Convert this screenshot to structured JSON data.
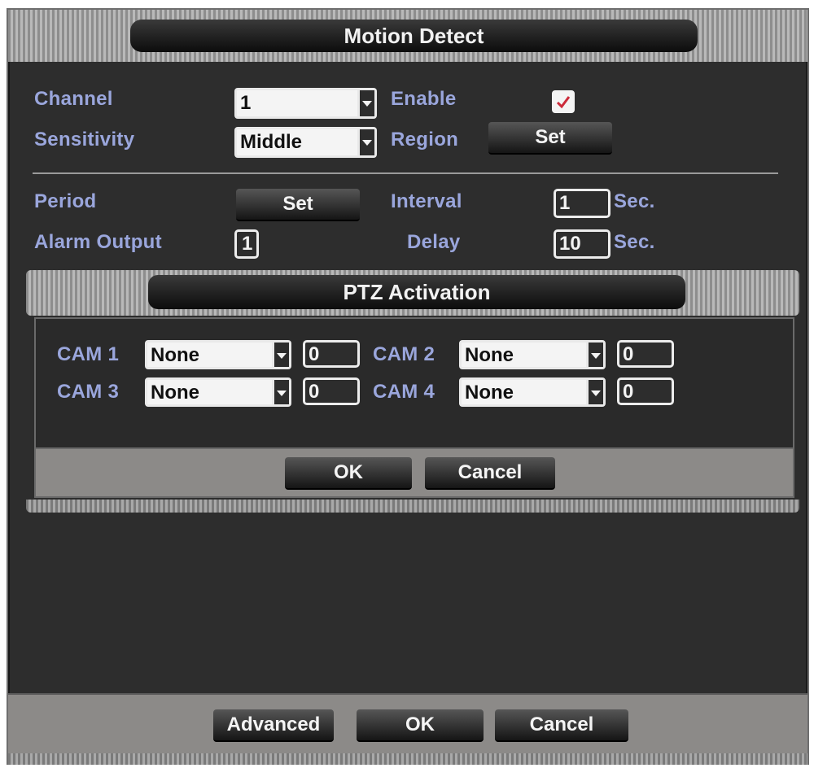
{
  "window": {
    "title": "Motion Detect"
  },
  "settings": {
    "channel_label": "Channel",
    "channel_value": "1",
    "enable_label": "Enable",
    "enable_checked": true,
    "sensitivity_label": "Sensitivity",
    "sensitivity_value": "Middle",
    "region_label": "Region",
    "region_button": "Set",
    "period_label": "Period",
    "period_button": "Set",
    "interval_label": "Interval",
    "interval_value": "1",
    "interval_unit": "Sec.",
    "alarm_output_label": "Alarm Output",
    "alarm_output_value": "1",
    "delay_label": "Delay",
    "delay_value": "10",
    "delay_unit": "Sec."
  },
  "ptz": {
    "title": "PTZ Activation",
    "cams": [
      {
        "label": "CAM 1",
        "mode": "None",
        "value": "0"
      },
      {
        "label": "CAM 2",
        "mode": "None",
        "value": "0"
      },
      {
        "label": "CAM 3",
        "mode": "None",
        "value": "0"
      },
      {
        "label": "CAM 4",
        "mode": "None",
        "value": "0"
      }
    ],
    "ok_label": "OK",
    "cancel_label": "Cancel"
  },
  "footer": {
    "advanced_label": "Advanced",
    "ok_label": "OK",
    "cancel_label": "Cancel"
  },
  "colors": {
    "label_blue": "#9aa6dc",
    "panel_bg": "#2d2d2d",
    "footer_gray": "#8c8a88",
    "check_mark": "#cc2a3a"
  }
}
